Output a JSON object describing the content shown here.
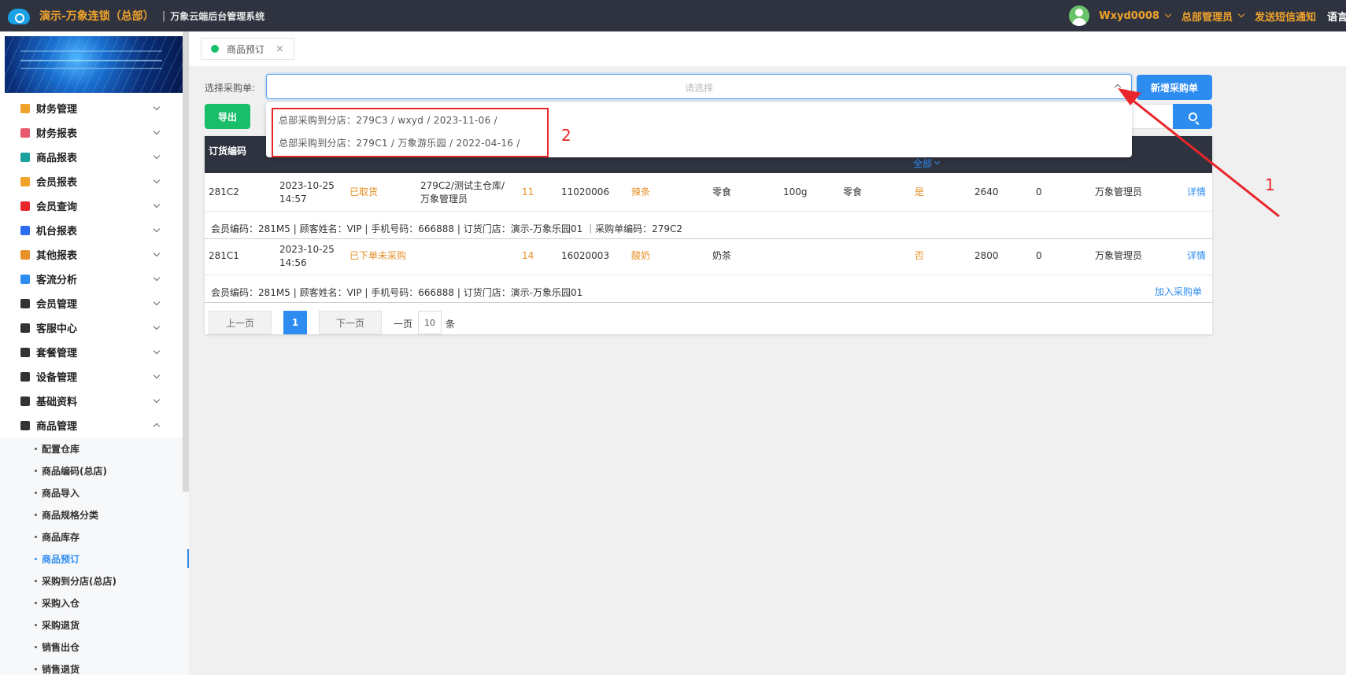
{
  "header": {
    "brand": "演示-万象连锁（总部）",
    "separator": "|",
    "system_name": "万象云端后台管理系统",
    "username": "Wxyd0008",
    "role": "总部管理员",
    "sms": "发送短信通知",
    "lang": "语言"
  },
  "sidebar": {
    "menu": [
      {
        "label": "财务管理",
        "icon": "calculator-icon",
        "color": "#f0a32a"
      },
      {
        "label": "财务报表",
        "icon": "report-icon",
        "color": "#e85a6b"
      },
      {
        "label": "商品报表",
        "icon": "goods-report-icon",
        "color": "#1aa1a0"
      },
      {
        "label": "会员报表",
        "icon": "member-report-icon",
        "color": "#f0a32a"
      },
      {
        "label": "会员查询",
        "icon": "member-query-icon",
        "color": "#e8262b"
      },
      {
        "label": "机台报表",
        "icon": "machine-report-icon",
        "color": "#2d6cf0"
      },
      {
        "label": "其他报表",
        "icon": "layers-icon",
        "color": "#e8902a"
      },
      {
        "label": "客流分析",
        "icon": "target-icon",
        "color": "#2d8cf0"
      },
      {
        "label": "会员管理",
        "icon": "user-circle-icon",
        "color": "#333333"
      },
      {
        "label": "客服中心",
        "icon": "headset-icon",
        "color": "#333333"
      },
      {
        "label": "套餐管理",
        "icon": "edit-icon",
        "color": "#333333"
      },
      {
        "label": "设备管理",
        "icon": "wrench-icon",
        "color": "#333333"
      },
      {
        "label": "基础资料",
        "icon": "document-icon",
        "color": "#333333"
      },
      {
        "label": "商品管理",
        "icon": "exchange-icon",
        "color": "#333333"
      }
    ],
    "submenu": [
      {
        "label": "配置仓库"
      },
      {
        "label": "商品编码(总店)"
      },
      {
        "label": "商品导入"
      },
      {
        "label": "商品规格分类"
      },
      {
        "label": "商品库存"
      },
      {
        "label": "商品预订"
      },
      {
        "label": "采购到分店(总店)"
      },
      {
        "label": "采购入仓"
      },
      {
        "label": "采购退货"
      },
      {
        "label": "销售出仓"
      },
      {
        "label": "销售退货"
      }
    ]
  },
  "tab": {
    "label": "商品预订",
    "close": "×"
  },
  "toolbar": {
    "select_label": "选择采购单:",
    "select_placeholder": "请选择",
    "new_button": "新增采购单",
    "export_button": "导出"
  },
  "dropdown": {
    "options": [
      "总部采购到分店：279C3 / wxyd / 2023-11-06 /",
      "总部采购到分店：279C1 / 万象游乐园 / 2022-04-16 /"
    ]
  },
  "annotations": {
    "one": "1",
    "two": "2",
    "color": "#e8262b"
  },
  "table": {
    "header_first": "订货编码",
    "header_filter": "全部",
    "rows": [
      {
        "code": "281C2",
        "time_date": "2023-10-25",
        "time_clock": "14:57",
        "status": "已取货",
        "warehouse_line1": "279C2/测试主仓库/",
        "warehouse_line2": "万象管理员",
        "qty": "11",
        "sku": "11020006",
        "name": "辣条",
        "category": "零食",
        "spec": "100g",
        "type": "零食",
        "flag": "是",
        "amount": "2640",
        "zero": "0",
        "operator": "万象管理员",
        "detail": "详情",
        "info": "会员编码：281M5 | 顾客姓名：VIP | 手机号码：666888 | 订货门店：演示-万象乐园01 ｜采购单编码：279C2",
        "extra_action": ""
      },
      {
        "code": "281C1",
        "time_date": "2023-10-25",
        "time_clock": "14:56",
        "status": "已下单未采购",
        "warehouse_line1": "",
        "warehouse_line2": "",
        "qty": "14",
        "sku": "16020003",
        "name": "酸奶",
        "category": "奶茶",
        "spec": "",
        "type": "",
        "flag": "否",
        "amount": "2800",
        "zero": "0",
        "operator": "万象管理员",
        "detail": "详情",
        "info": "会员编码：281M5 | 顾客姓名：VIP | 手机号码：666888 | 订货门店：演示-万象乐园01",
        "extra_action": "加入采购单"
      }
    ]
  },
  "pager": {
    "prev": "上一页",
    "current": "1",
    "next": "下一页",
    "per_page_label": "一页",
    "per_page": "10",
    "unit": "条"
  }
}
